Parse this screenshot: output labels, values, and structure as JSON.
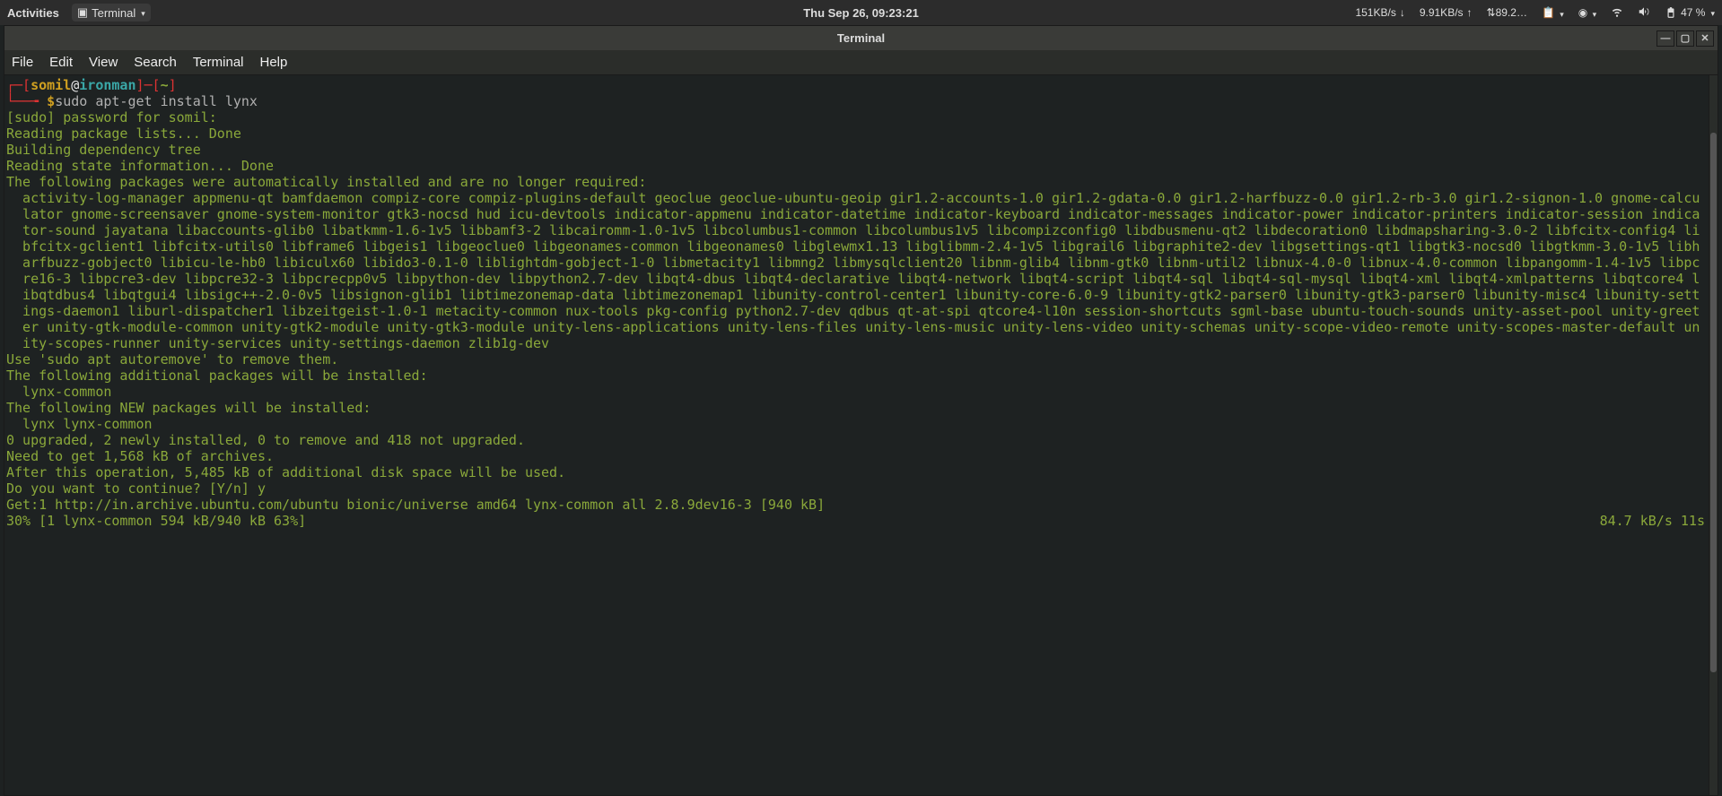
{
  "top": {
    "activities": "Activities",
    "app_name": "Terminal",
    "datetime": "Thu Sep 26, 09:23:21",
    "net_down": "151KB/s",
    "net_up": "9.91KB/s",
    "net_misc": "⇅89.2…",
    "battery": "47 %"
  },
  "window": {
    "title": "Terminal",
    "menu": [
      "File",
      "Edit",
      "View",
      "Search",
      "Terminal",
      "Help"
    ]
  },
  "prompt": {
    "l_br": "┌─[",
    "user": "somil",
    "at": "@",
    "host": "ironman",
    "r_br": "]─[",
    "cwd": "~",
    "end": "]",
    "l2": "└──╼ ",
    "dollar": "$",
    "command": "sudo apt-get install lynx"
  },
  "out": {
    "sudo": "[sudo] password for somil:",
    "l1": "Reading package lists... Done",
    "l2": "Building dependency tree",
    "l3": "Reading state information... Done",
    "l4": "The following packages were automatically installed and are no longer required:",
    "pkgs": "activity-log-manager appmenu-qt bamfdaemon compiz-core compiz-plugins-default geoclue geoclue-ubuntu-geoip gir1.2-accounts-1.0 gir1.2-gdata-0.0 gir1.2-harfbuzz-0.0 gir1.2-rb-3.0 gir1.2-signon-1.0 gnome-calculator gnome-screensaver gnome-system-monitor gtk3-nocsd hud icu-devtools indicator-appmenu indicator-datetime indicator-keyboard indicator-messages indicator-power indicator-printers indicator-session indicator-sound jayatana libaccounts-glib0 libatkmm-1.6-1v5 libbamf3-2 libcairomm-1.0-1v5 libcolumbus1-common libcolumbus1v5 libcompizconfig0 libdbusmenu-qt2 libdecoration0 libdmapsharing-3.0-2 libfcitx-config4 libfcitx-gclient1 libfcitx-utils0 libframe6 libgeis1 libgeoclue0 libgeonames-common libgeonames0 libglewmx1.13 libglibmm-2.4-1v5 libgrail6 libgraphite2-dev libgsettings-qt1 libgtk3-nocsd0 libgtkmm-3.0-1v5 libharfbuzz-gobject0 libicu-le-hb0 libiculx60 libido3-0.1-0 liblightdm-gobject-1-0 libmetacity1 libmng2 libmysqlclient20 libnm-glib4 libnm-gtk0 libnm-util2 libnux-4.0-0 libnux-4.0-common libpangomm-1.4-1v5 libpcre16-3 libpcre3-dev libpcre32-3 libpcrecpp0v5 libpython-dev libpython2.7-dev libqt4-dbus libqt4-declarative libqt4-network libqt4-script libqt4-sql libqt4-sql-mysql libqt4-xml libqt4-xmlpatterns libqtcore4 libqtdbus4 libqtgui4 libsigc++-2.0-0v5 libsignon-glib1 libtimezonemap-data libtimezonemap1 libunity-control-center1 libunity-core-6.0-9 libunity-gtk2-parser0 libunity-gtk3-parser0 libunity-misc4 libunity-settings-daemon1 liburl-dispatcher1 libzeitgeist-1.0-1 metacity-common nux-tools pkg-config python2.7-dev qdbus qt-at-spi qtcore4-l10n session-shortcuts sgml-base ubuntu-touch-sounds unity-asset-pool unity-greeter unity-gtk-module-common unity-gtk2-module unity-gtk3-module unity-lens-applications unity-lens-files unity-lens-music unity-lens-video unity-schemas unity-scope-video-remote unity-scopes-master-default unity-scopes-runner unity-services unity-settings-daemon zlib1g-dev",
    "l5": "Use 'sudo apt autoremove' to remove them.",
    "l6": "The following additional packages will be installed:",
    "add_pkgs": "lynx-common",
    "l7": "The following NEW packages will be installed:",
    "new_pkgs": "lynx lynx-common",
    "l8": "0 upgraded, 2 newly installed, 0 to remove and 418 not upgraded.",
    "l9": "Need to get 1,568 kB of archives.",
    "l10": "After this operation, 5,485 kB of additional disk space will be used.",
    "l11": "Do you want to continue? [Y/n] y",
    "l12": "Get:1 http://in.archive.ubuntu.com/ubuntu bionic/universe amd64 lynx-common all 2.8.9dev16-3 [940 kB]",
    "progress_left": "30% [1 lynx-common 594 kB/940 kB 63%]",
    "progress_right": "84.7 kB/s 11s"
  }
}
